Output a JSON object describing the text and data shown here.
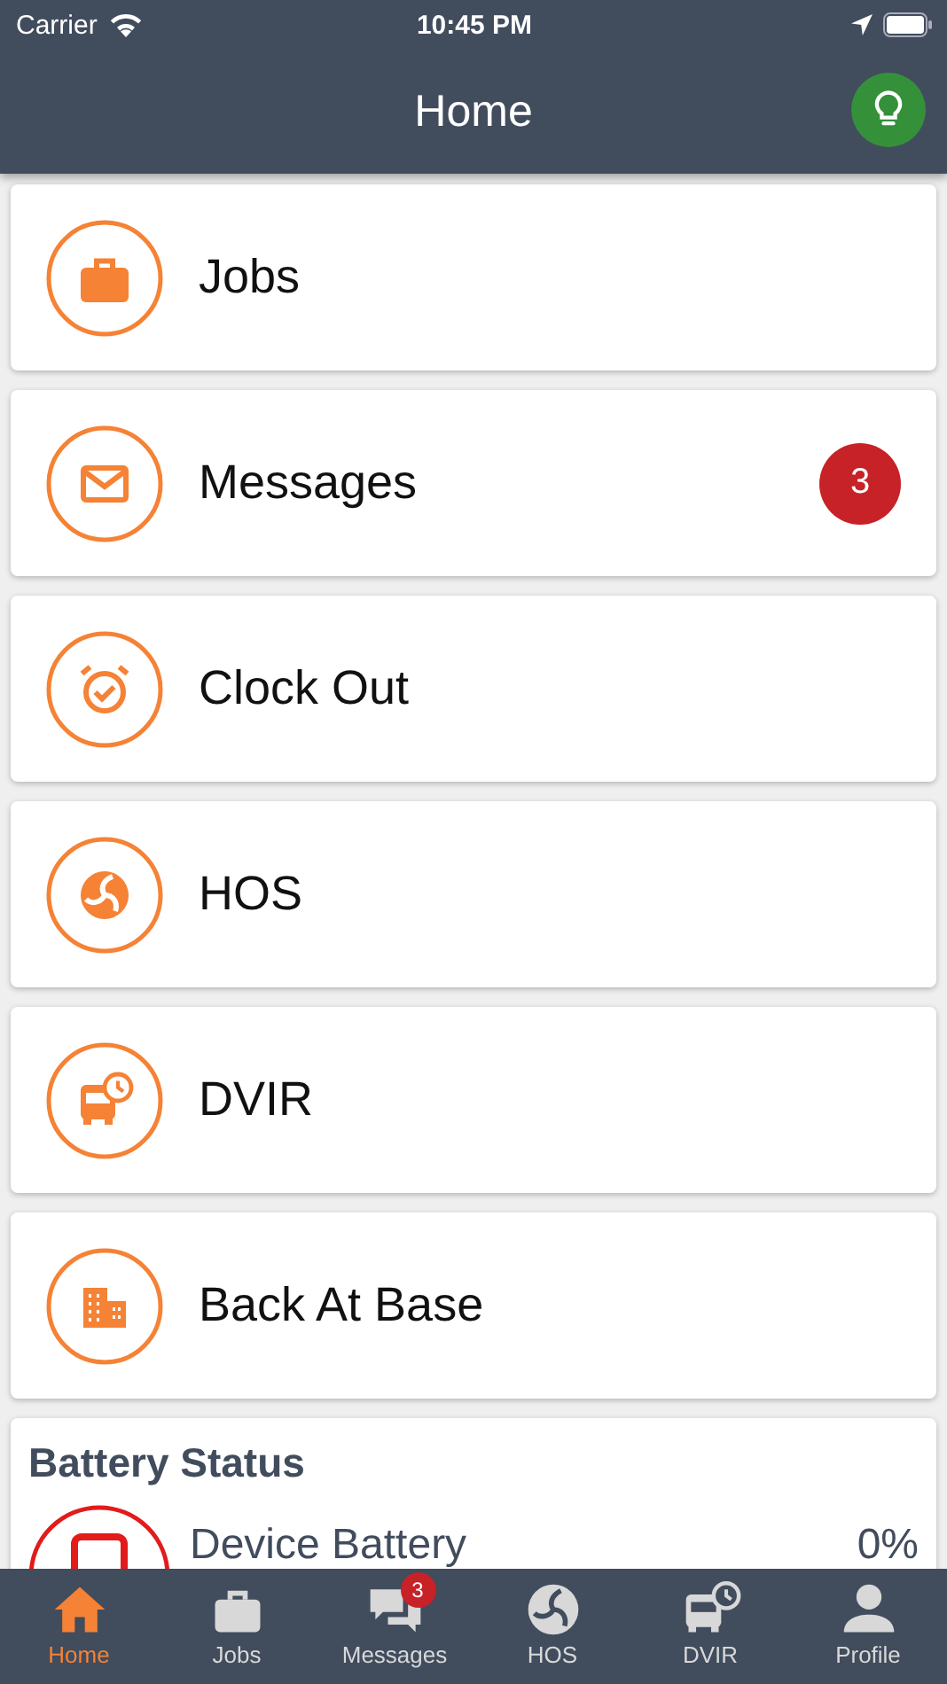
{
  "status_bar": {
    "carrier": "Carrier",
    "time": "10:45 PM"
  },
  "nav": {
    "title": "Home"
  },
  "menu": [
    {
      "label": "Jobs"
    },
    {
      "label": "Messages",
      "badge": "3"
    },
    {
      "label": "Clock Out"
    },
    {
      "label": "HOS"
    },
    {
      "label": "DVIR"
    },
    {
      "label": "Back At Base"
    }
  ],
  "battery_status": {
    "title": "Battery Status",
    "items": [
      {
        "label": "Device Battery",
        "value": "0%"
      }
    ]
  },
  "tab_bar": [
    {
      "label": "Home",
      "selected": true
    },
    {
      "label": "Jobs",
      "selected": false
    },
    {
      "label": "Messages",
      "selected": false,
      "badge": "3"
    },
    {
      "label": "HOS",
      "selected": false
    },
    {
      "label": "DVIR",
      "selected": false
    },
    {
      "label": "Profile",
      "selected": false
    }
  ]
}
